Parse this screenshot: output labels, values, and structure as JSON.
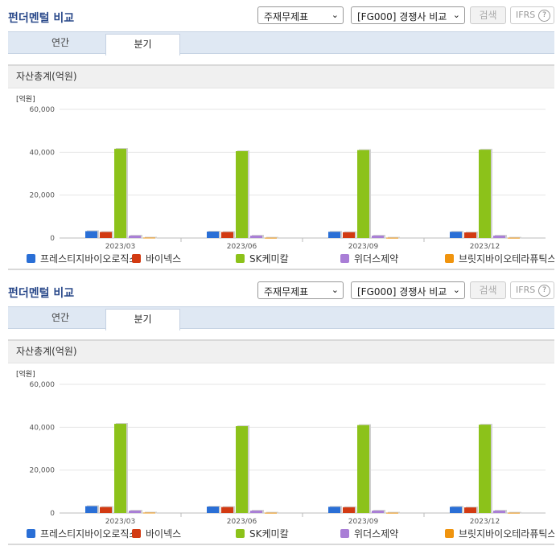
{
  "title": "펀더멘털 비교",
  "statement_select": "주재무제표",
  "compare_select": "[FG000] 경쟁사 비교",
  "search_label": "검색",
  "ifrs_label": "IFRS",
  "help_glyph": "?",
  "tabs": [
    "연간",
    "분기"
  ],
  "section_title": "자산총계(억원)",
  "chart_data": {
    "type": "bar",
    "unit_label": "[억원]",
    "ylim": [
      0,
      60000
    ],
    "yticks": [
      "0",
      "20,000",
      "40,000",
      "60,000"
    ],
    "ytick_values": [
      0,
      20000,
      40000,
      60000
    ],
    "categories": [
      "2023/03",
      "2023/06",
      "2023/09",
      "2023/12"
    ],
    "grid": true,
    "legend_position": "bottom",
    "series": [
      {
        "name": "프레스티지바이오로직스",
        "color": "#2a6fd6",
        "values": [
          3200,
          3000,
          2900,
          2900
        ]
      },
      {
        "name": "바이넥스",
        "color": "#d23a12",
        "values": [
          2800,
          2800,
          2700,
          2600
        ]
      },
      {
        "name": "SK케미칼",
        "color": "#8cc21a",
        "values": [
          41600,
          40500,
          41000,
          41200
        ]
      },
      {
        "name": "위더스제약",
        "color": "#a97ed6",
        "values": [
          1100,
          1100,
          1100,
          1100
        ]
      },
      {
        "name": "브릿지바이오테라퓨틱스",
        "color": "#f0940e",
        "values": [
          200,
          150,
          150,
          150
        ]
      }
    ]
  }
}
